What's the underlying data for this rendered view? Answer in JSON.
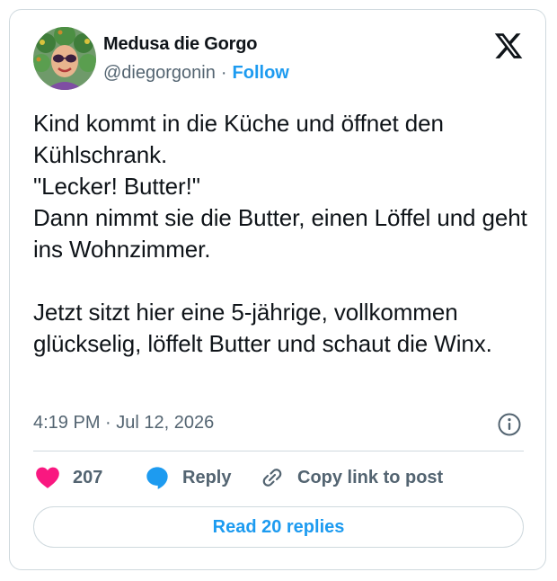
{
  "author": {
    "display_name": "Medusa die Gorgo",
    "handle": "@diegorgonin",
    "separator": "·",
    "follow_label": "Follow"
  },
  "tweet": {
    "text": "Kind kommt in die Küche und öffnet den Kühlschrank.\n\"Lecker! Butter!\"\nDann nimmt sie die Butter, einen Löffel und geht ins Wohnzimmer.\n\nJetzt sitzt hier eine 5-jährige, vollkommen glückselig, löffelt Butter und schaut die Winx.",
    "timestamp": "4:19 PM · Jul 12, 2026"
  },
  "actions": {
    "like_count": "207",
    "reply_label": "Reply",
    "copy_link_label": "Copy link to post"
  },
  "footer": {
    "read_replies_label": "Read 20 replies"
  },
  "icons": {
    "logo": "x-logo-icon",
    "info": "info-icon",
    "like": "heart-icon",
    "reply": "speech-bubble-icon",
    "copy": "link-icon"
  },
  "colors": {
    "accent": "#1d9bf0",
    "like": "#f91880",
    "secondary_text": "#536471",
    "border": "#cfd9de"
  }
}
